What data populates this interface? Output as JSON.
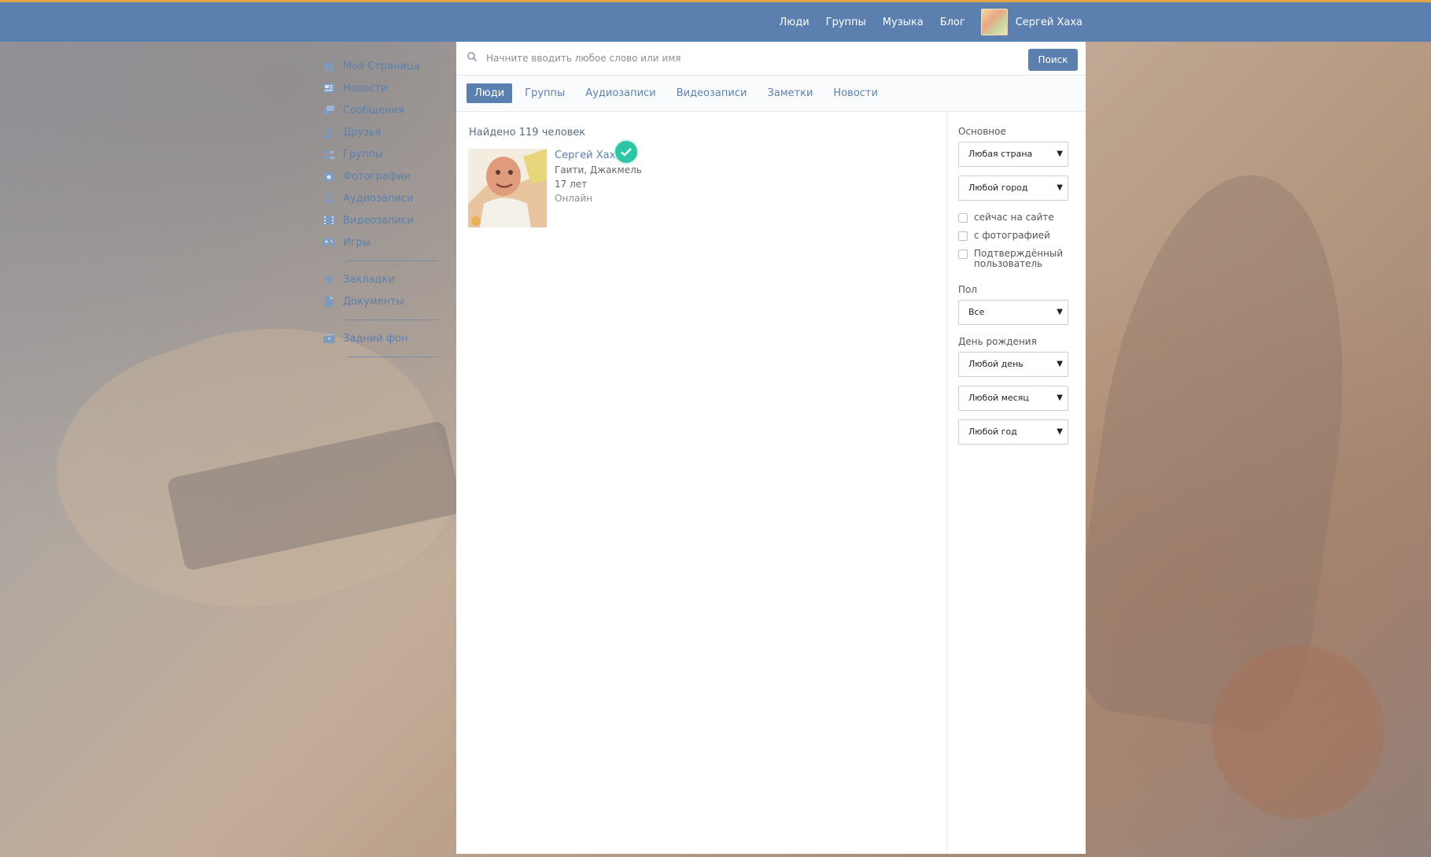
{
  "topbar": {
    "nav": [
      "Люди",
      "Группы",
      "Музыка",
      "Блог"
    ],
    "user_name": "Сергей Хаха"
  },
  "left_menu": {
    "items": [
      {
        "label": "Моя Страница",
        "icon": "home-icon"
      },
      {
        "label": "Новости",
        "icon": "news-icon"
      },
      {
        "label": "Сообщения",
        "icon": "messages-icon"
      },
      {
        "label": "Друзья",
        "icon": "friend-icon"
      },
      {
        "label": "Группы",
        "icon": "groups-icon"
      },
      {
        "label": "Фотографии",
        "icon": "camera-icon"
      },
      {
        "label": "Аудиозаписи",
        "icon": "music-icon"
      },
      {
        "label": "Видеозаписи",
        "icon": "video-icon"
      },
      {
        "label": "Игры",
        "icon": "gamepad-icon"
      }
    ],
    "items2": [
      {
        "label": "Закладки",
        "icon": "star-icon"
      },
      {
        "label": "Документы",
        "icon": "document-icon"
      }
    ],
    "items3": [
      {
        "label": "Задний фон",
        "icon": "background-icon"
      }
    ]
  },
  "search": {
    "placeholder": "Начните вводить любое слово или имя",
    "button": "Поиск"
  },
  "tabs": [
    "Люди",
    "Группы",
    "Аудиозаписи",
    "Видеозаписи",
    "Заметки",
    "Новости"
  ],
  "results": {
    "found_text": "Найдено 119 человек",
    "person": {
      "name": "Сергей Хаха",
      "location": "Гаити, Джакмель",
      "age": "17 лет",
      "status": "Онлайн"
    }
  },
  "filters": {
    "basic_title": "Основное",
    "country": "Любая страна",
    "city": "Любой город",
    "checkboxes": [
      "сейчас на сайте",
      "с фотографией",
      "Подтверждённый пользователь"
    ],
    "gender_title": "Пол",
    "gender": "Все",
    "birthday_title": "День рождения",
    "day": "Любой день",
    "month": "Любой месяц",
    "year": "Любой год"
  },
  "colors": {
    "accent": "#5b80b0",
    "top_border": "#e2a54a",
    "verified": "#2ec4a6"
  }
}
